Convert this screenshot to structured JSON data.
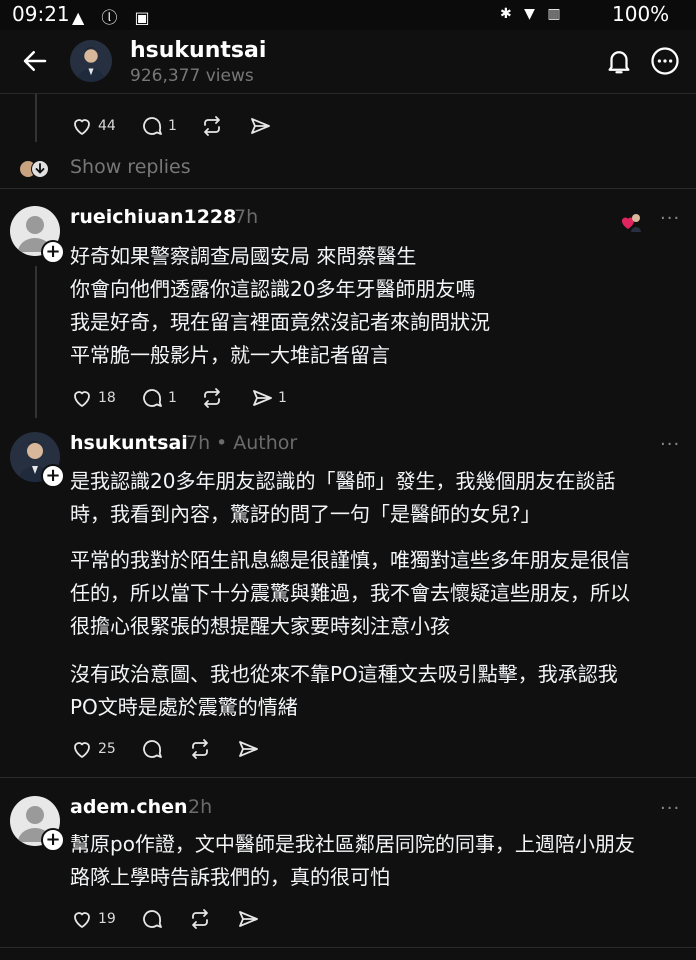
{
  "status_bar": {
    "time": "09:21",
    "left_icons": "▲ ⓛ ▣",
    "right_icons": "✱ ▼ ▥",
    "battery": "100%"
  },
  "header": {
    "title": "hsukuntsai",
    "views": "926,377 views"
  },
  "prev_post": {
    "likes": "44",
    "comments": "1",
    "show_replies": "Show replies"
  },
  "comments": [
    {
      "username": "rueichiuan1228",
      "time": "7h",
      "author_tag": "",
      "lines": [
        "好奇如果警察調查局國安局 來問蔡醫生",
        "你會向他們透露你這認識20多年牙醫師朋友嗎",
        "我是好奇，現在留言裡面竟然沒記者來詢問狀況",
        "平常脆一般影片，就一大堆記者留言"
      ],
      "likes": "18",
      "comments": "1",
      "shares": "1"
    },
    {
      "username": "hsukuntsai",
      "time": "7h",
      "author_tag": "• Author",
      "lines": [
        "是我認識20多年朋友認識的「醫師」發生，我幾個朋友在談話",
        "時，我看到內容，驚訝的問了一句「是醫師的女兒?」",
        "平常的我對於陌生訊息總是很謹慎，唯獨對這些多年朋友是很信",
        "任的，所以當下十分震驚與難過，我不會去懷疑這些朋友，所以",
        "很擔心很緊張的想提醒大家要時刻注意小孩",
        "沒有政治意圖、我也從來不靠PO這種文去吸引點擊，我承認我",
        "PO文時是處於震驚的情緒"
      ],
      "likes": "25",
      "comments": "",
      "shares": ""
    },
    {
      "username": "adem.chen",
      "time": "2h",
      "author_tag": "",
      "lines": [
        "幫原po作證，文中醫師是我社區鄰居同院的同事，上週陪小朋友",
        "路隊上學時告訴我們的，真的很可怕"
      ],
      "likes": "19",
      "comments": "",
      "shares": ""
    }
  ]
}
